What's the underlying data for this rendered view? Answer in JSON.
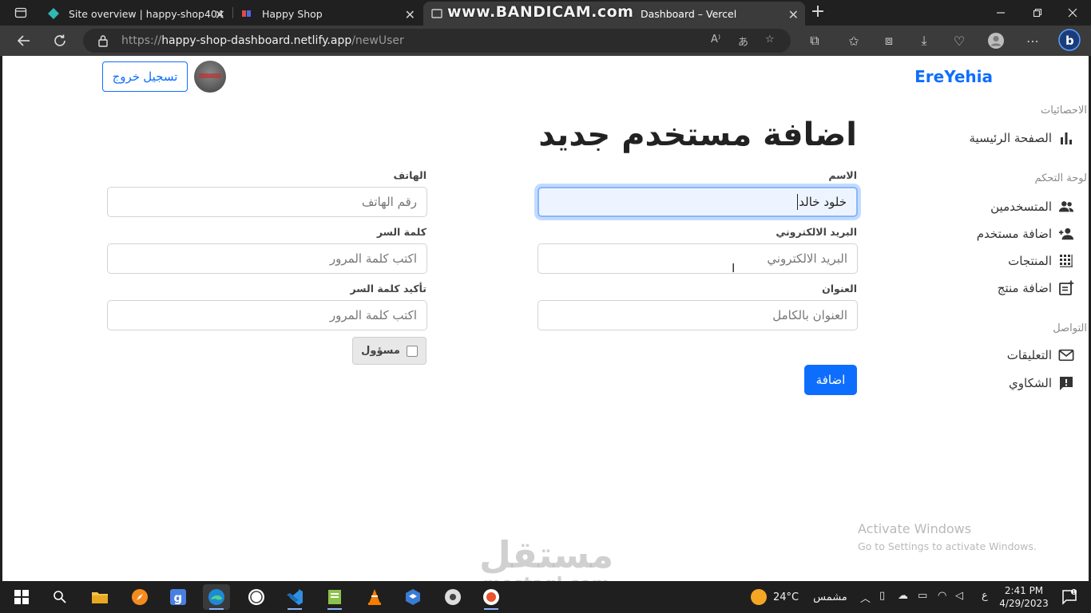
{
  "browser": {
    "tabs": [
      {
        "title": "Site overview | happy-shop404",
        "active": false
      },
      {
        "title": "Happy Shop",
        "active": false
      },
      {
        "title": "Dashboard – Vercel",
        "active": true
      }
    ],
    "recorder_overlay": "www.BANDICAM.com",
    "url_prefix": "https://",
    "url_host": "happy-shop-dashboard.netlify.app",
    "url_path": "/newUser"
  },
  "header": {
    "brand": "EreYehia",
    "logout_label": "تسجيل خروج"
  },
  "sidebar": {
    "sections": [
      {
        "title": "الاحصائيات",
        "items": [
          {
            "label": "الصفحة الرئيسية",
            "icon": "bar-chart-icon"
          }
        ]
      },
      {
        "title": "لوحة التحكم",
        "items": [
          {
            "label": "المتسخدمين",
            "icon": "users-icon"
          },
          {
            "label": "اضافة مستخدم",
            "icon": "add-user-icon"
          },
          {
            "label": "المنتجات",
            "icon": "grid-icon"
          },
          {
            "label": "اضافة منتج",
            "icon": "add-note-icon"
          }
        ]
      },
      {
        "title": "التواصل",
        "items": [
          {
            "label": "التعليقات",
            "icon": "mail-icon"
          },
          {
            "label": "الشكاوي",
            "icon": "report-icon"
          }
        ]
      }
    ]
  },
  "form": {
    "title": "اضافة مستخدم جديد",
    "fields": {
      "name": {
        "label": "الاسم",
        "value": "خلود خالد",
        "placeholder": ""
      },
      "phone": {
        "label": "الهاتف",
        "value": "",
        "placeholder": "رقم الهاتف"
      },
      "email": {
        "label": "البريد الالكتروني",
        "value": "",
        "placeholder": "البريد الالكتروني"
      },
      "password": {
        "label": "كلمة السر",
        "value": "",
        "placeholder": "اكتب كلمة المرور"
      },
      "address": {
        "label": "العنوان",
        "value": "",
        "placeholder": "العنوان بالكامل"
      },
      "confirm": {
        "label": "تأكيد كلمة السر",
        "value": "",
        "placeholder": "اكتب كلمة المرور"
      }
    },
    "admin_label": "مسؤول",
    "submit_label": "اضافة"
  },
  "os_watermark": {
    "line1": "Activate Windows",
    "line2": "Go to Settings to activate Windows."
  },
  "site_watermark": {
    "line1": "مستقل",
    "line2": "mostaql.com"
  },
  "taskbar": {
    "weather_temp": "24°C",
    "weather_text": "مشمس",
    "lang": "ع",
    "time": "2:41 PM",
    "date": "4/29/2023"
  },
  "colors": {
    "accent": "#0d6efd",
    "page_bg": "#ffffff",
    "chrome_bg": "#202020"
  }
}
